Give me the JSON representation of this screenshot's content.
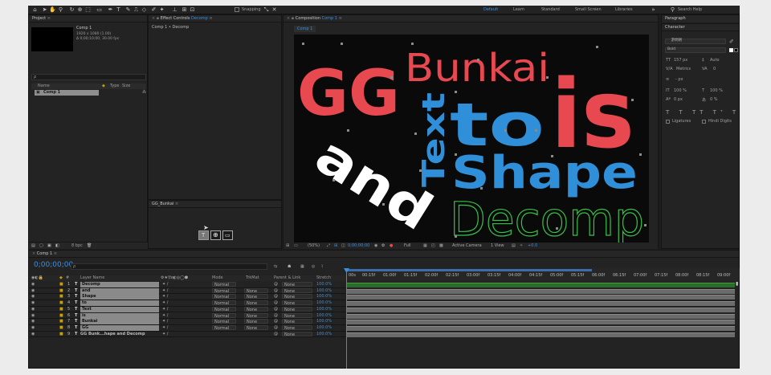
{
  "toolbar": {
    "snapping": "Snapping",
    "workspaces": [
      "Default",
      "Learn",
      "Standard",
      "Small Screen",
      "Libraries"
    ],
    "search": "Search Help"
  },
  "project": {
    "tab": "Project",
    "comp_name": "Comp 1",
    "comp_info": [
      "1920 x 1080 (1.00)",
      "Δ 0;00;10;00, 30.00 fps"
    ],
    "search_placeholder": "ρ",
    "columns": {
      "name": "Name",
      "type": "Type",
      "size": "Size"
    },
    "items": [
      {
        "name": "Comp 1",
        "type": "",
        "size": ""
      }
    ],
    "bpc": "8 bpc"
  },
  "effect_controls": {
    "tab": "Effect Controls",
    "tab_layer": "Decomp",
    "path": "Comp 1 • Decomp"
  },
  "gg_panel": {
    "tab": "GG_Bunkai"
  },
  "composition": {
    "tab": "Composition",
    "tab_comp": "Comp 1",
    "subtab": "Comp 1",
    "zoom": "(50%)",
    "timecode": "0;00;00;00",
    "resolution": "Full",
    "camera": "Active Camera",
    "view": "1 View",
    "plus": "+0.0",
    "words": {
      "gg": "GG",
      "bunkai": "Bunkai",
      "is": "is",
      "to": "to",
      "text": "Text",
      "and": "and",
      "shape": "Shape",
      "decomp": "Decomp"
    }
  },
  "paragraph": {
    "tab": "Paragraph"
  },
  "character": {
    "tab": "Character",
    "font": "　游明朝",
    "style": "Bold",
    "size": "157 px",
    "leading": "Auto",
    "tracking_label": "Metrics",
    "tracking_value": "0",
    "stroke": "- px",
    "vscale": "100 %",
    "hscale": "100 %",
    "baseline": "0 px",
    "tsume": "0 %",
    "ligatures": "Ligatures",
    "hindi": "Hindi Digits"
  },
  "timeline": {
    "tab": "Comp 1",
    "timecode": "0;00;00;00",
    "col_layer_name": "Layer Name",
    "col_mode": "Mode",
    "col_trkmat": "TrkMat",
    "col_parent": "Parent & Link",
    "col_stretch": "Stretch",
    "ruler": [
      "00s",
      "00:15f",
      "01:00f",
      "01:15f",
      "02:00f",
      "02:15f",
      "03:00f",
      "03:15f",
      "04:00f",
      "04:15f",
      "05:00f",
      "05:15f",
      "06:00f",
      "06:15f",
      "07:00f",
      "07:15f",
      "08:00f",
      "08:15f",
      "09:00f"
    ],
    "layers": [
      {
        "num": "1",
        "name": "Decomp",
        "mode": "Normal",
        "trkmat": "",
        "parent": "None",
        "stretch": "100.0%"
      },
      {
        "num": "2",
        "name": "and",
        "mode": "Normal",
        "trkmat": "None",
        "parent": "None",
        "stretch": "100.0%"
      },
      {
        "num": "3",
        "name": "Shape",
        "mode": "Normal",
        "trkmat": "None",
        "parent": "None",
        "stretch": "100.0%"
      },
      {
        "num": "4",
        "name": "to",
        "mode": "Normal",
        "trkmat": "None",
        "parent": "None",
        "stretch": "100.0%"
      },
      {
        "num": "5",
        "name": "Text",
        "mode": "Normal",
        "trkmat": "None",
        "parent": "None",
        "stretch": "100.0%"
      },
      {
        "num": "6",
        "name": "is",
        "mode": "Normal",
        "trkmat": "None",
        "parent": "None",
        "stretch": "100.0%"
      },
      {
        "num": "7",
        "name": "Bunkai",
        "mode": "Normal",
        "trkmat": "None",
        "parent": "None",
        "stretch": "100.0%"
      },
      {
        "num": "8",
        "name": "GG",
        "mode": "Normal",
        "trkmat": "None",
        "parent": "None",
        "stretch": "100.0%"
      },
      {
        "num": "9",
        "name": "GG Bunk...hape and Decomp",
        "mode": "",
        "trkmat": "",
        "parent": "None",
        "stretch": "100.0%"
      }
    ]
  },
  "colors": {
    "accent": "#3b8fe0",
    "red": "#e8484f",
    "blue": "#2f8fd8",
    "green": "#38c048",
    "white": "#ffffff"
  }
}
